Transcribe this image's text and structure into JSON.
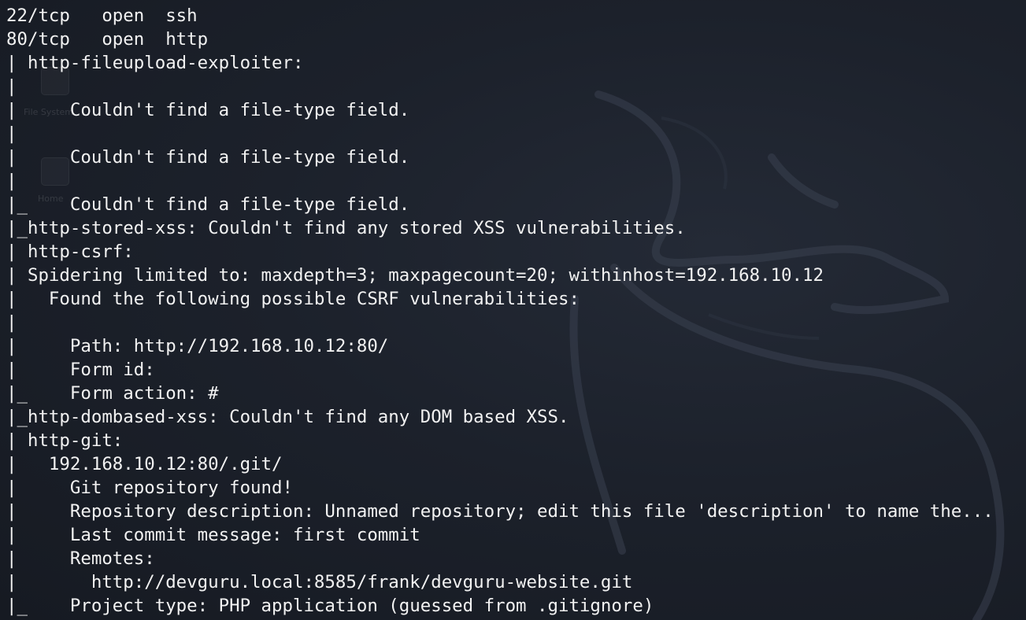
{
  "terminal": {
    "lines": [
      "22/tcp   open  ssh",
      "80/tcp   open  http",
      "| http-fileupload-exploiter:",
      "|",
      "|     Couldn't find a file-type field.",
      "|",
      "|     Couldn't find a file-type field.",
      "|",
      "|_    Couldn't find a file-type field.",
      "|_http-stored-xss: Couldn't find any stored XSS vulnerabilities.",
      "| http-csrf:",
      "| Spidering limited to: maxdepth=3; maxpagecount=20; withinhost=192.168.10.12",
      "|   Found the following possible CSRF vulnerabilities:",
      "|",
      "|     Path: http://192.168.10.12:80/",
      "|     Form id:",
      "|_    Form action: #",
      "|_http-dombased-xss: Couldn't find any DOM based XSS.",
      "| http-git:",
      "|   192.168.10.12:80/.git/",
      "|     Git repository found!",
      "|     Repository description: Unnamed repository; edit this file 'description' to name the...",
      "|     Last commit message: first commit",
      "|     Remotes:",
      "|       http://devguru.local:8585/frank/devguru-website.git",
      "|_    Project type: PHP application (guessed from .gitignore)"
    ]
  },
  "desktop": {
    "icons": [
      {
        "name": "file-system-icon",
        "label": "File System"
      },
      {
        "name": "home-icon",
        "label": "Home"
      }
    ]
  },
  "colors": {
    "text": "#f2f2f2",
    "background": "#1b2029"
  }
}
